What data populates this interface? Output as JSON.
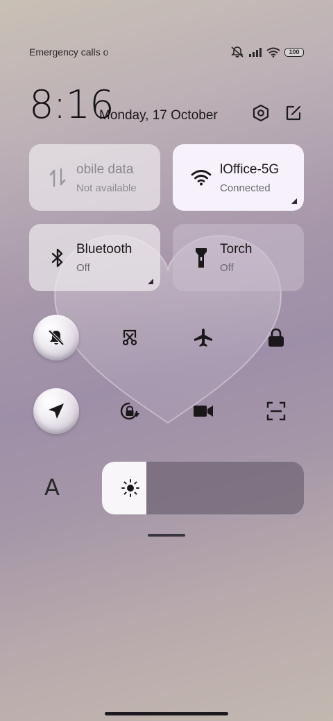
{
  "status_bar": {
    "carrier_text": "Emergency calls o",
    "battery_level": "100",
    "icons": [
      "mute-icon",
      "signal-icon",
      "wifi-icon",
      "battery-icon"
    ]
  },
  "header": {
    "time": "8:16",
    "date": "Monday, 17 October",
    "settings_icon": "settings-hex-icon",
    "edit_icon": "edit-icon"
  },
  "tiles": [
    {
      "name": "obile data",
      "status": "Not available",
      "icon": "mobile-data-icon",
      "state": "disabled"
    },
    {
      "name": "lOffice-5G",
      "status": "Connected",
      "icon": "wifi-icon",
      "state": "on"
    },
    {
      "name": "Bluetooth",
      "status": "Off",
      "icon": "bluetooth-icon",
      "state": "off"
    },
    {
      "name": "Torch",
      "status": "Off",
      "icon": "torch-icon",
      "state": "off"
    }
  ],
  "quick_toggles": [
    {
      "icon": "silent-bell-icon",
      "active": true
    },
    {
      "icon": "screenshot-cut-icon",
      "active": false
    },
    {
      "icon": "airplane-icon",
      "active": false
    },
    {
      "icon": "lock-icon",
      "active": false
    },
    {
      "icon": "location-icon",
      "active": true
    },
    {
      "icon": "rotation-lock-icon",
      "active": false
    },
    {
      "icon": "video-camera-icon",
      "active": false
    },
    {
      "icon": "scan-icon",
      "active": false
    }
  ],
  "controls": {
    "font_label": "A",
    "brightness_level": 0.22
  },
  "colors": {
    "active_tile": "#f6f1fb",
    "tile": "#ece8ec",
    "bubble": "#f2eff4"
  }
}
